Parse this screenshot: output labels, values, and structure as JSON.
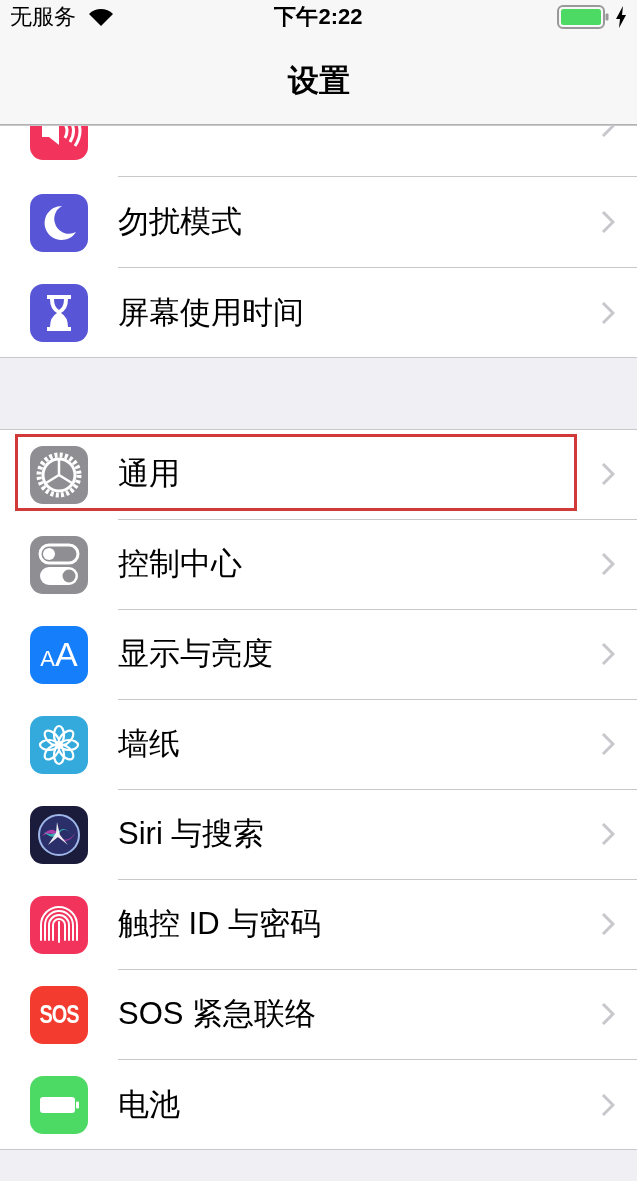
{
  "status_bar": {
    "carrier": "无服务",
    "time": "下午2:22"
  },
  "nav": {
    "title": "设置"
  },
  "groups": [
    {
      "items": [
        {
          "kind": "sound",
          "cut_off": true,
          "highlighted": false
        },
        {
          "label": "勿扰模式",
          "kind": "moon",
          "highlighted": false
        },
        {
          "label": "屏幕使用时间",
          "kind": "hourglass",
          "highlighted": false
        }
      ]
    },
    {
      "items": [
        {
          "label": "通用",
          "kind": "gear",
          "highlighted": true
        },
        {
          "label": "控制中心",
          "kind": "toggles",
          "highlighted": false
        },
        {
          "label": "显示与亮度",
          "kind": "textsize",
          "icon_text": "AA",
          "highlighted": false
        },
        {
          "label": "墙纸",
          "kind": "flower",
          "highlighted": false
        },
        {
          "label": "Siri 与搜索",
          "kind": "siri",
          "highlighted": false
        },
        {
          "label": "触控 ID 与密码",
          "kind": "fingerprint",
          "highlighted": false
        },
        {
          "label": "SOS 紧急联络",
          "kind": "sos",
          "icon_text": "SOS",
          "highlighted": false
        },
        {
          "label": "电池",
          "kind": "battery",
          "highlighted": false
        }
      ]
    }
  ]
}
